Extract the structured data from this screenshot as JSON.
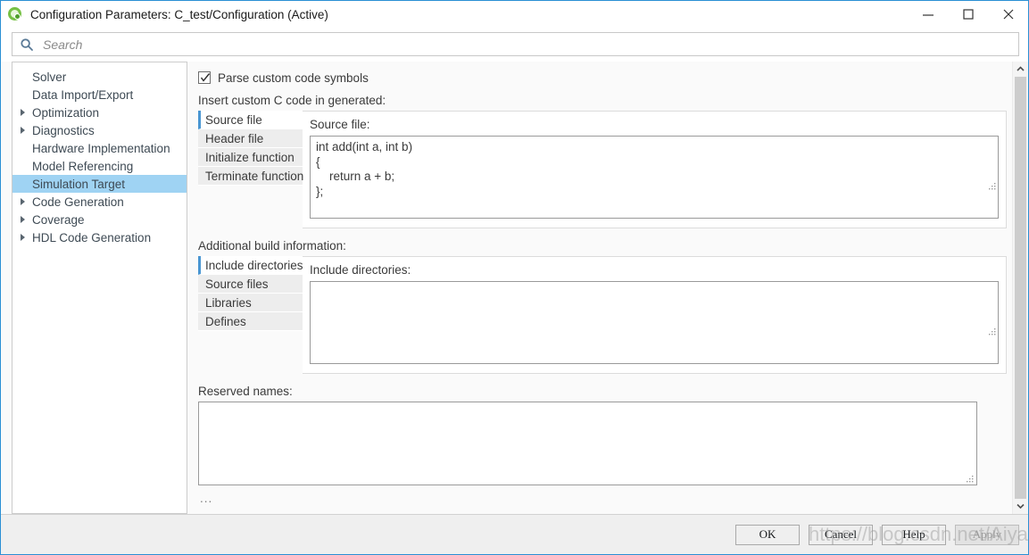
{
  "window": {
    "title": "Configuration Parameters: C_test/Configuration (Active)",
    "app_icon": "simulink-icon",
    "controls": {
      "minimize": "minimize-icon",
      "maximize": "maximize-icon",
      "close": "close-icon"
    },
    "border_color": "#2a8fd4"
  },
  "search": {
    "placeholder": "Search",
    "value": "",
    "icon": "search-icon"
  },
  "sidebar": {
    "items": [
      {
        "label": "Solver",
        "expandable": false,
        "selected": false
      },
      {
        "label": "Data Import/Export",
        "expandable": false,
        "selected": false
      },
      {
        "label": "Optimization",
        "expandable": true,
        "selected": false
      },
      {
        "label": "Diagnostics",
        "expandable": true,
        "selected": false
      },
      {
        "label": "Hardware Implementation",
        "expandable": false,
        "selected": false
      },
      {
        "label": "Model Referencing",
        "expandable": false,
        "selected": false
      },
      {
        "label": "Simulation Target",
        "expandable": false,
        "selected": true
      },
      {
        "label": "Code Generation",
        "expandable": true,
        "selected": false
      },
      {
        "label": "Coverage",
        "expandable": true,
        "selected": false
      },
      {
        "label": "HDL Code Generation",
        "expandable": true,
        "selected": false
      }
    ],
    "selection_color": "#9fd3f3"
  },
  "main": {
    "parse_checkbox": {
      "label": "Parse custom code symbols",
      "checked": true
    },
    "custom_code": {
      "section_label": "Insert custom C code in generated:",
      "tabs": [
        {
          "label": "Source file",
          "active": true
        },
        {
          "label": "Header file",
          "active": false
        },
        {
          "label": "Initialize function",
          "active": false
        },
        {
          "label": "Terminate function",
          "active": false
        }
      ],
      "pane_label": "Source file:",
      "pane_value": "int add(int a, int b)\n{\n    return a + b;\n};"
    },
    "build_info": {
      "section_label": "Additional build information:",
      "tabs": [
        {
          "label": "Include directories",
          "active": true
        },
        {
          "label": "Source files",
          "active": false
        },
        {
          "label": "Libraries",
          "active": false
        },
        {
          "label": "Defines",
          "active": false
        }
      ],
      "pane_label": "Include directories:",
      "pane_value": ""
    },
    "reserved_names": {
      "label": "Reserved names:",
      "value": ""
    },
    "overflow_indicator": "..."
  },
  "scrollbar": {
    "up_icon": "chevron-up-icon",
    "down_icon": "chevron-down-icon"
  },
  "footer": {
    "buttons": [
      {
        "label": "OK",
        "disabled": false
      },
      {
        "label": "Cancel",
        "disabled": false
      },
      {
        "label": "Help",
        "disabled": false
      },
      {
        "label": "Apply",
        "disabled": true
      }
    ],
    "watermark": "https://blog.csdn.net/Aiyanghong"
  }
}
